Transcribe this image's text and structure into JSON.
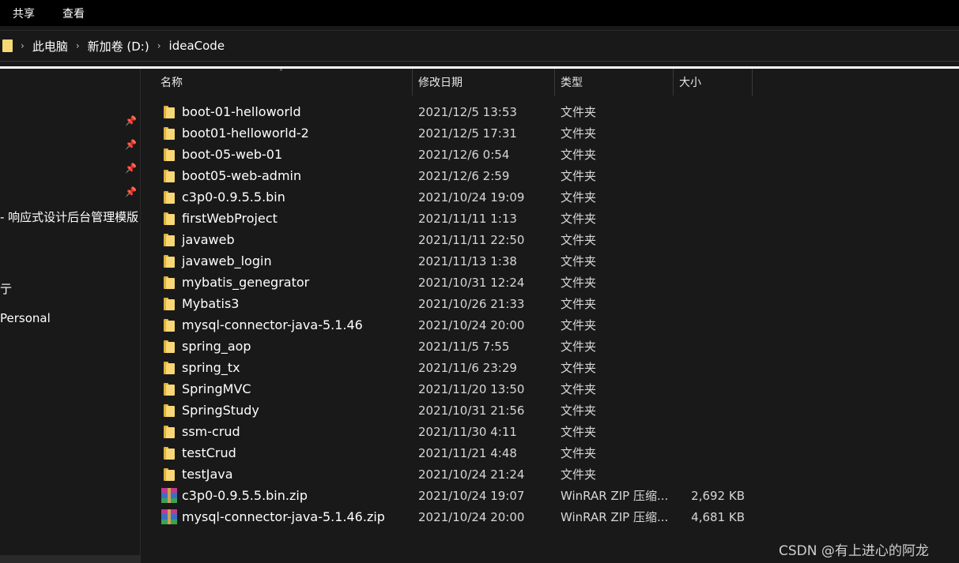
{
  "ribbon": {
    "tabs": [
      "共享",
      "查看"
    ]
  },
  "address": {
    "crumbs": [
      "此电脑",
      "新加卷 (D:)",
      "ideaCode"
    ]
  },
  "nav": {
    "item_partial_1": "- 响应式设计后台管理模版",
    "item_partial_2": "亍",
    "item_partial_3": "Personal"
  },
  "columns": {
    "name": "名称",
    "date": "修改日期",
    "type": "类型",
    "size": "大小"
  },
  "files": [
    {
      "name": "boot-01-helloworld",
      "date": "2021/12/5 13:53",
      "type": "文件夹",
      "size": "",
      "icon": "folder-icon"
    },
    {
      "name": "boot01-helloworld-2",
      "date": "2021/12/5 17:31",
      "type": "文件夹",
      "size": "",
      "icon": "folder-icon"
    },
    {
      "name": "boot-05-web-01",
      "date": "2021/12/6 0:54",
      "type": "文件夹",
      "size": "",
      "icon": "folder-icon"
    },
    {
      "name": "boot05-web-admin",
      "date": "2021/12/6 2:59",
      "type": "文件夹",
      "size": "",
      "icon": "folder-icon"
    },
    {
      "name": "c3p0-0.9.5.5.bin",
      "date": "2021/10/24 19:09",
      "type": "文件夹",
      "size": "",
      "icon": "folder-icon"
    },
    {
      "name": "firstWebProject",
      "date": "2021/11/11 1:13",
      "type": "文件夹",
      "size": "",
      "icon": "folder-icon"
    },
    {
      "name": "javaweb",
      "date": "2021/11/11 22:50",
      "type": "文件夹",
      "size": "",
      "icon": "folder-icon"
    },
    {
      "name": "javaweb_login",
      "date": "2021/11/13 1:38",
      "type": "文件夹",
      "size": "",
      "icon": "folder-icon"
    },
    {
      "name": "mybatis_genegrator",
      "date": "2021/10/31 12:24",
      "type": "文件夹",
      "size": "",
      "icon": "folder-icon"
    },
    {
      "name": "Mybatis3",
      "date": "2021/10/26 21:33",
      "type": "文件夹",
      "size": "",
      "icon": "folder-icon"
    },
    {
      "name": "mysql-connector-java-5.1.46",
      "date": "2021/10/24 20:00",
      "type": "文件夹",
      "size": "",
      "icon": "folder-icon"
    },
    {
      "name": "spring_aop",
      "date": "2021/11/5 7:55",
      "type": "文件夹",
      "size": "",
      "icon": "folder-icon"
    },
    {
      "name": "spring_tx",
      "date": "2021/11/6 23:29",
      "type": "文件夹",
      "size": "",
      "icon": "folder-icon"
    },
    {
      "name": "SpringMVC",
      "date": "2021/11/20 13:50",
      "type": "文件夹",
      "size": "",
      "icon": "folder-icon"
    },
    {
      "name": "SpringStudy",
      "date": "2021/10/31 21:56",
      "type": "文件夹",
      "size": "",
      "icon": "folder-icon"
    },
    {
      "name": "ssm-crud",
      "date": "2021/11/30 4:11",
      "type": "文件夹",
      "size": "",
      "icon": "folder-icon"
    },
    {
      "name": "testCrud",
      "date": "2021/11/21 4:48",
      "type": "文件夹",
      "size": "",
      "icon": "folder-icon"
    },
    {
      "name": "testJava",
      "date": "2021/10/24 21:24",
      "type": "文件夹",
      "size": "",
      "icon": "folder-icon"
    },
    {
      "name": "c3p0-0.9.5.5.bin.zip",
      "date": "2021/10/24 19:07",
      "type": "WinRAR ZIP 压缩...",
      "size": "2,692 KB",
      "icon": "winrar-zip-icon"
    },
    {
      "name": "mysql-connector-java-5.1.46.zip",
      "date": "2021/10/24 20:00",
      "type": "WinRAR ZIP 压缩...",
      "size": "4,681 KB",
      "icon": "winrar-zip-icon"
    }
  ],
  "watermark": "CSDN @有上进心的阿龙",
  "colors": {
    "background": "#191919",
    "ribbon": "#000000",
    "folder": "#f8d775"
  }
}
